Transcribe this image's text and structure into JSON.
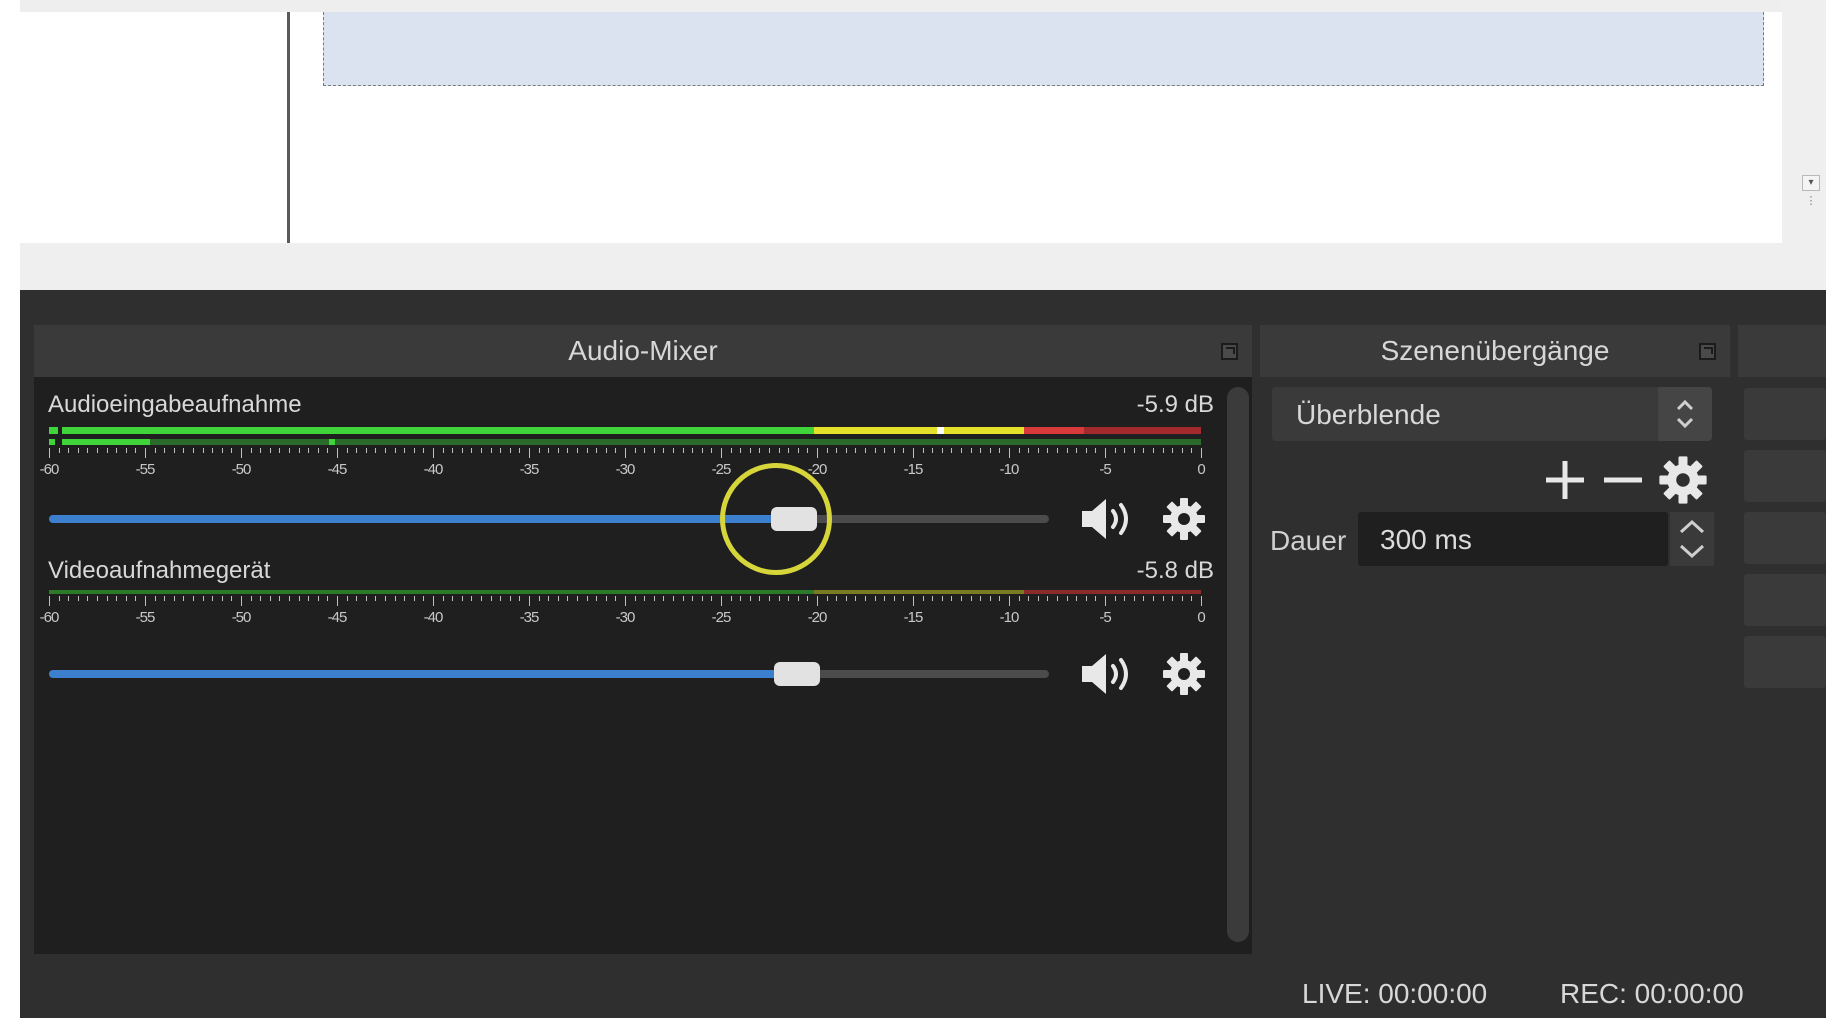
{
  "audio_mixer": {
    "title": "Audio-Mixer",
    "scale_labels": [
      "-60",
      "-55",
      "-50",
      "-45",
      "-40",
      "-35",
      "-30",
      "-25",
      "-20",
      "-15",
      "-10",
      "-5",
      "0"
    ],
    "channels": [
      {
        "name": "Audioeingabeaufnahme",
        "volume_label": "-5.9 dB",
        "volume_db": -5.9,
        "fader_level": 0.745,
        "meter_level": 0.87,
        "highlighted": true
      },
      {
        "name": "Videoaufnahmegerät",
        "volume_label": "-5.8 dB",
        "volume_db": -5.8,
        "fader_level": 0.748,
        "meter_level": 0.0,
        "highlighted": false
      }
    ],
    "icons": {
      "mute": "speaker-volume-icon",
      "settings": "gear-icon",
      "float": "float-window-icon"
    }
  },
  "scene_transitions": {
    "title": "Szenenübergänge",
    "selected_transition": "Überblende",
    "duration_label": "Dauer",
    "duration_value": "300 ms",
    "icons": {
      "add": "plus-icon",
      "remove": "minus-icon",
      "settings": "gear-icon"
    }
  },
  "status_bar": {
    "live": "LIVE: 00:00:00",
    "rec": "REC: 00:00:00"
  },
  "colors": {
    "meter_green": "#3fd43a",
    "meter_yellow": "#e5e12b",
    "meter_red": "#d8393b",
    "fader_fill": "#3c7fcf",
    "highlight": "#d6d53a"
  }
}
